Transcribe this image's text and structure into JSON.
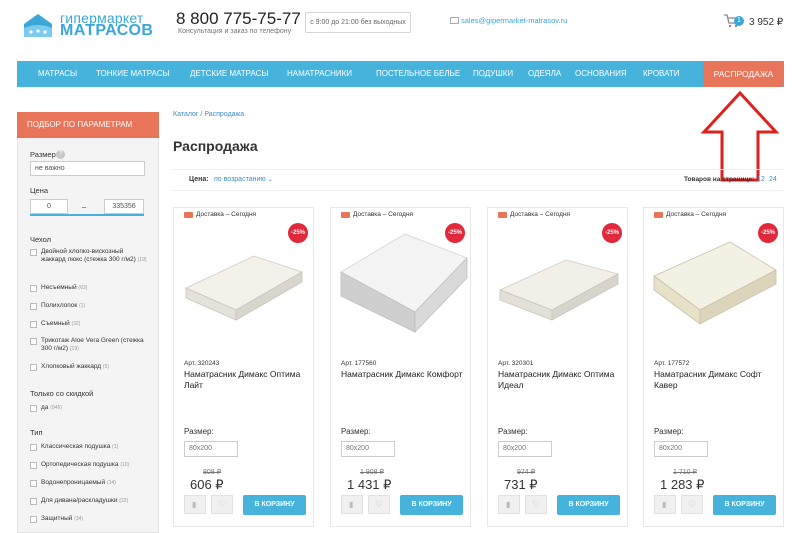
{
  "header": {
    "logo_top": "гипермаркет",
    "logo_bottom": "МАТРАСОВ",
    "phone": "8 800 775-75-77",
    "phone_sub": "Консультация и заказ по телефону",
    "hours": "с 9:00 до 21:00 без выходных",
    "email": "sales@gipermarket-matrasov.ru",
    "cart_count": "1",
    "cart_total": "3 952 ₽"
  },
  "colors": {
    "brand_blue": "#46b3dd",
    "accent_orange": "#e8745a",
    "discount_red": "#e02a3c",
    "annotation_arrow": "#e0201c"
  },
  "nav": {
    "items": [
      "Матрасы",
      "Тонкие матрасы",
      "Детские матрасы",
      "Наматрасники",
      "Постельное белье",
      "Подушки",
      "Одеяла",
      "Основания",
      "Кровати"
    ],
    "sale": "Распродажа"
  },
  "sidebar": {
    "title": "Подбор по параметрам",
    "size_label": "Размер",
    "size_placeholder": "не важно",
    "price_label": "Цена",
    "price_from": "0",
    "price_dash": "–",
    "price_to": "335356",
    "cover_label": "Чехол",
    "cover_items": [
      {
        "text": "Двойной хлопко-вискозный жаккард люкс (стежка 300 г/м2)",
        "count": "(19)"
      },
      {
        "text": "Несъемный",
        "count": "(63)"
      },
      {
        "text": "Полихлопок",
        "count": "(1)"
      },
      {
        "text": "Съемный",
        "count": "(32)"
      },
      {
        "text": "Трикотаж Aloe Vera Green (стежка 300 г/м2)",
        "count": "(19)"
      },
      {
        "text": "Хлопковый жаккард",
        "count": "(5)"
      }
    ],
    "discount_label": "Только со скидкой",
    "discount_items": [
      {
        "text": "да",
        "count": "(946)"
      }
    ],
    "type_label": "Тип",
    "type_items": [
      {
        "text": "Классическая подушка",
        "count": "(1)"
      },
      {
        "text": "Ортопедическая подушка",
        "count": "(10)"
      },
      {
        "text": "Водонепроницаемый",
        "count": "(14)"
      },
      {
        "text": "Для дивана/раскладушки",
        "count": "(22)"
      },
      {
        "text": "Защитный",
        "count": "(34)"
      }
    ]
  },
  "breadcrumb": {
    "catalog": "Каталог",
    "separator": "/",
    "current": "Распродажа"
  },
  "page_title": "Распродажа",
  "sort": {
    "label": "Цена:",
    "value": "по возрастанию",
    "per_page_label": "Товаров на странице:",
    "per_page_options": [
      "12",
      "24"
    ]
  },
  "products": [
    {
      "delivery": "Доставка – Сегодня",
      "discount": "-25%",
      "sku": "Арт. 320243",
      "name": "Наматрасник Димакс Оптима Лайт",
      "size_label": "Размер:",
      "size": "80x200",
      "old_price": "808 ₽",
      "price": "606 ₽",
      "buy": "В корзину"
    },
    {
      "delivery": "Доставка – Сегодня",
      "discount": "-25%",
      "sku": "Арт. 177560",
      "name": "Наматрасник Димакс Комфорт",
      "size_label": "Размер:",
      "size": "80x200",
      "old_price": "1 908 ₽",
      "price": "1 431 ₽",
      "buy": "В корзину"
    },
    {
      "delivery": "Доставка – Сегодня",
      "discount": "-25%",
      "sku": "Арт. 320301",
      "name": "Наматрасник Димакс Оптима Идеал",
      "size_label": "Размер:",
      "size": "80x200",
      "old_price": "974 ₽",
      "price": "731 ₽",
      "buy": "В корзину"
    },
    {
      "delivery": "Доставка – Сегодня",
      "discount": "-25%",
      "sku": "Арт. 177572",
      "name": "Наматрасник Димакс Софт Кавер",
      "size_label": "Размер:",
      "size": "80x200",
      "old_price": "1 710 ₽",
      "price": "1 283 ₽",
      "buy": "В корзину"
    }
  ]
}
